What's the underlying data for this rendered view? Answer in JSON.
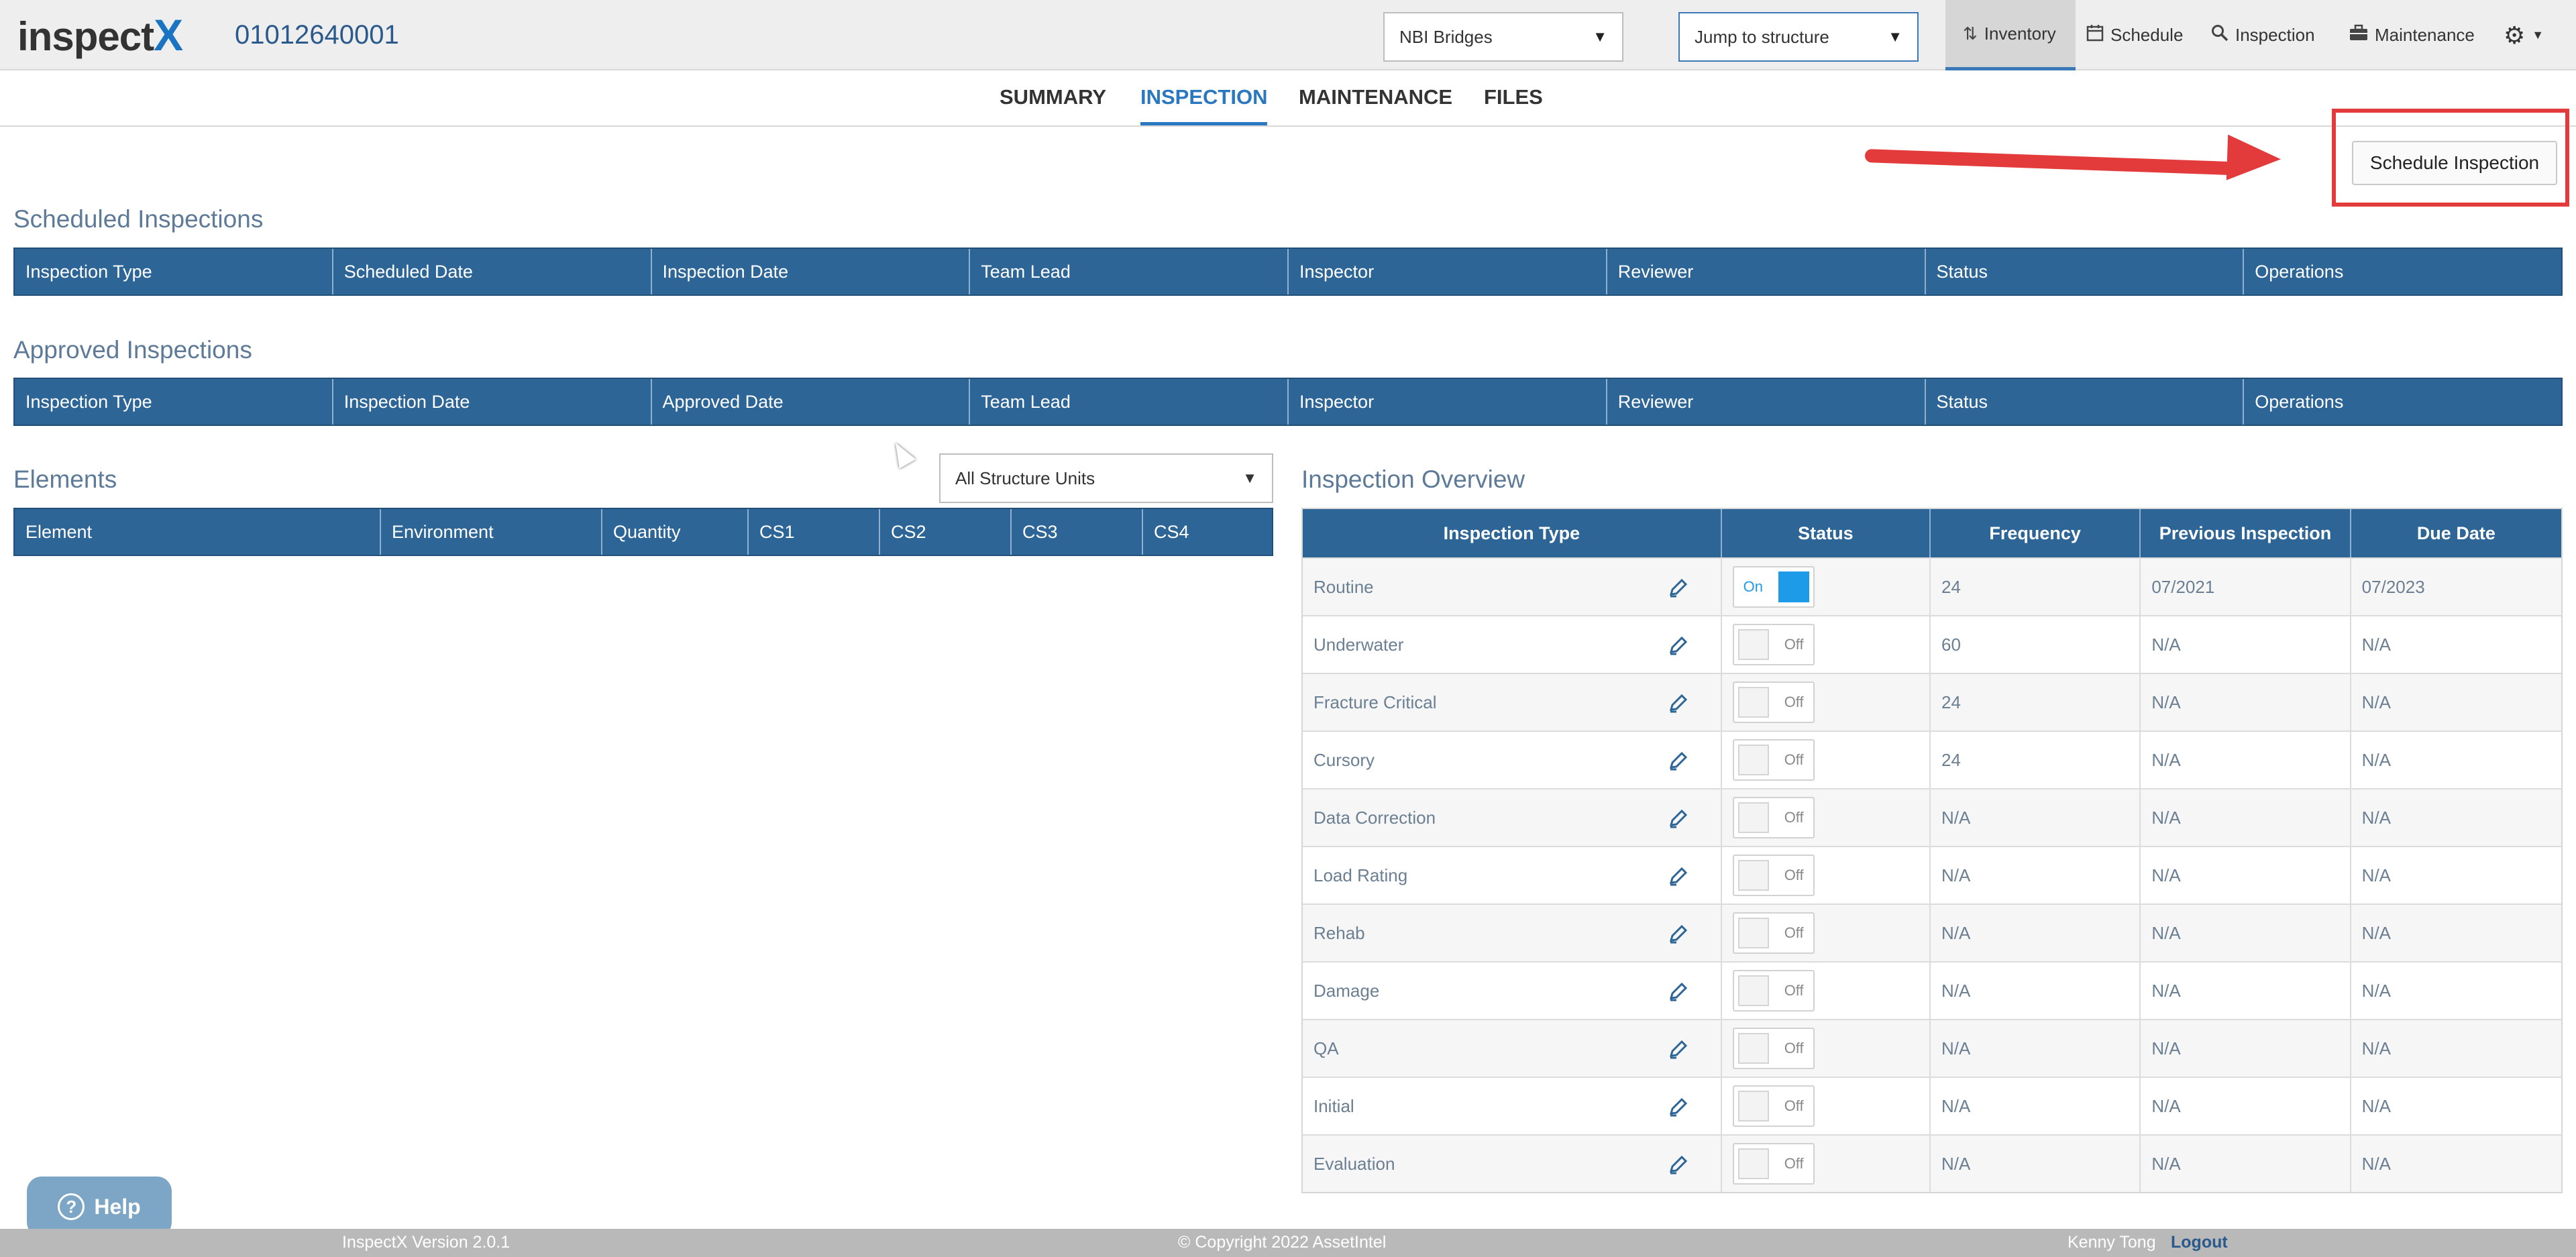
{
  "header": {
    "logo_text": "inspect",
    "logo_x": "X",
    "structure_id": "01012640001",
    "asset_select": "NBI Bridges",
    "jump_select": "Jump to structure",
    "nav": [
      {
        "label": "Inventory",
        "icon": "sort-icon"
      },
      {
        "label": "Schedule",
        "icon": "calendar-icon"
      },
      {
        "label": "Inspection",
        "icon": "search-icon"
      },
      {
        "label": "Maintenance",
        "icon": "toolbox-icon"
      }
    ]
  },
  "tabs": [
    "SUMMARY",
    "INSPECTION",
    "MAINTENANCE",
    "FILES"
  ],
  "active_tab": "INSPECTION",
  "schedule_button": "Schedule Inspection",
  "scheduled": {
    "title": "Scheduled Inspections",
    "columns": [
      "Inspection Type",
      "Scheduled Date",
      "Inspection Date",
      "Team Lead",
      "Inspector",
      "Reviewer",
      "Status",
      "Operations"
    ]
  },
  "approved": {
    "title": "Approved Inspections",
    "columns": [
      "Inspection Type",
      "Inspection Date",
      "Approved Date",
      "Team Lead",
      "Inspector",
      "Reviewer",
      "Status",
      "Operations"
    ]
  },
  "elements": {
    "title": "Elements",
    "unit_select": "All Structure Units",
    "columns": [
      "Element",
      "Environment",
      "Quantity",
      "CS1",
      "CS2",
      "CS3",
      "CS4"
    ]
  },
  "overview": {
    "title": "Inspection Overview",
    "columns": [
      "Inspection Type",
      "Status",
      "Frequency",
      "Previous Inspection",
      "Due Date"
    ],
    "rows": [
      {
        "type": "Routine",
        "status": "On",
        "frequency": "24",
        "previous": "07/2021",
        "due": "07/2023"
      },
      {
        "type": "Underwater",
        "status": "Off",
        "frequency": "60",
        "previous": "N/A",
        "due": "N/A"
      },
      {
        "type": "Fracture Critical",
        "status": "Off",
        "frequency": "24",
        "previous": "N/A",
        "due": "N/A"
      },
      {
        "type": "Cursory",
        "status": "Off",
        "frequency": "24",
        "previous": "N/A",
        "due": "N/A"
      },
      {
        "type": "Data Correction",
        "status": "Off",
        "frequency": "N/A",
        "previous": "N/A",
        "due": "N/A"
      },
      {
        "type": "Load Rating",
        "status": "Off",
        "frequency": "N/A",
        "previous": "N/A",
        "due": "N/A"
      },
      {
        "type": "Rehab",
        "status": "Off",
        "frequency": "N/A",
        "previous": "N/A",
        "due": "N/A"
      },
      {
        "type": "Damage",
        "status": "Off",
        "frequency": "N/A",
        "previous": "N/A",
        "due": "N/A"
      },
      {
        "type": "QA",
        "status": "Off",
        "frequency": "N/A",
        "previous": "N/A",
        "due": "N/A"
      },
      {
        "type": "Initial",
        "status": "Off",
        "frequency": "N/A",
        "previous": "N/A",
        "due": "N/A"
      },
      {
        "type": "Evaluation",
        "status": "Off",
        "frequency": "N/A",
        "previous": "N/A",
        "due": "N/A"
      }
    ]
  },
  "help": "Help",
  "footer": {
    "version": "InspectX Version 2.0.1",
    "copyright": "© Copyright 2022 AssetIntel",
    "user": "Kenny Tong",
    "logout": "Logout"
  },
  "colors": {
    "accent": "#2d6597",
    "annotation": "#e33b3b",
    "toggle_on": "#1e9be8"
  }
}
